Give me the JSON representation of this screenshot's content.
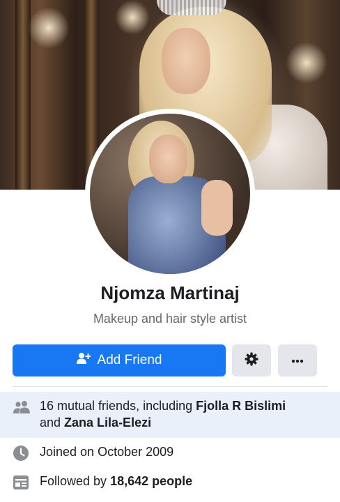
{
  "profile": {
    "name": "Njomza Martinaj",
    "bio": "Makeup and hair style artist"
  },
  "actions": {
    "add_friend_label": "Add Friend",
    "settings_icon": "gear-icon",
    "more_icon": "more-dots-icon"
  },
  "details": {
    "mutual": {
      "prefix": "16 mutual friends, including ",
      "friend1": "Fjolla R Bislimi",
      "and": "and ",
      "friend2": "Zana Lila-Elezi",
      "icon": "friends-icon"
    },
    "joined": {
      "text": "Joined on October 2009",
      "icon": "clock-icon"
    },
    "followers": {
      "prefix": "Followed by ",
      "count": "18,642 people",
      "icon": "feed-icon"
    }
  },
  "colors": {
    "accent": "#1877f2",
    "button_grey": "#e4e6eb",
    "highlight_row": "#eaf0fa",
    "secondary_text": "#65676b"
  }
}
